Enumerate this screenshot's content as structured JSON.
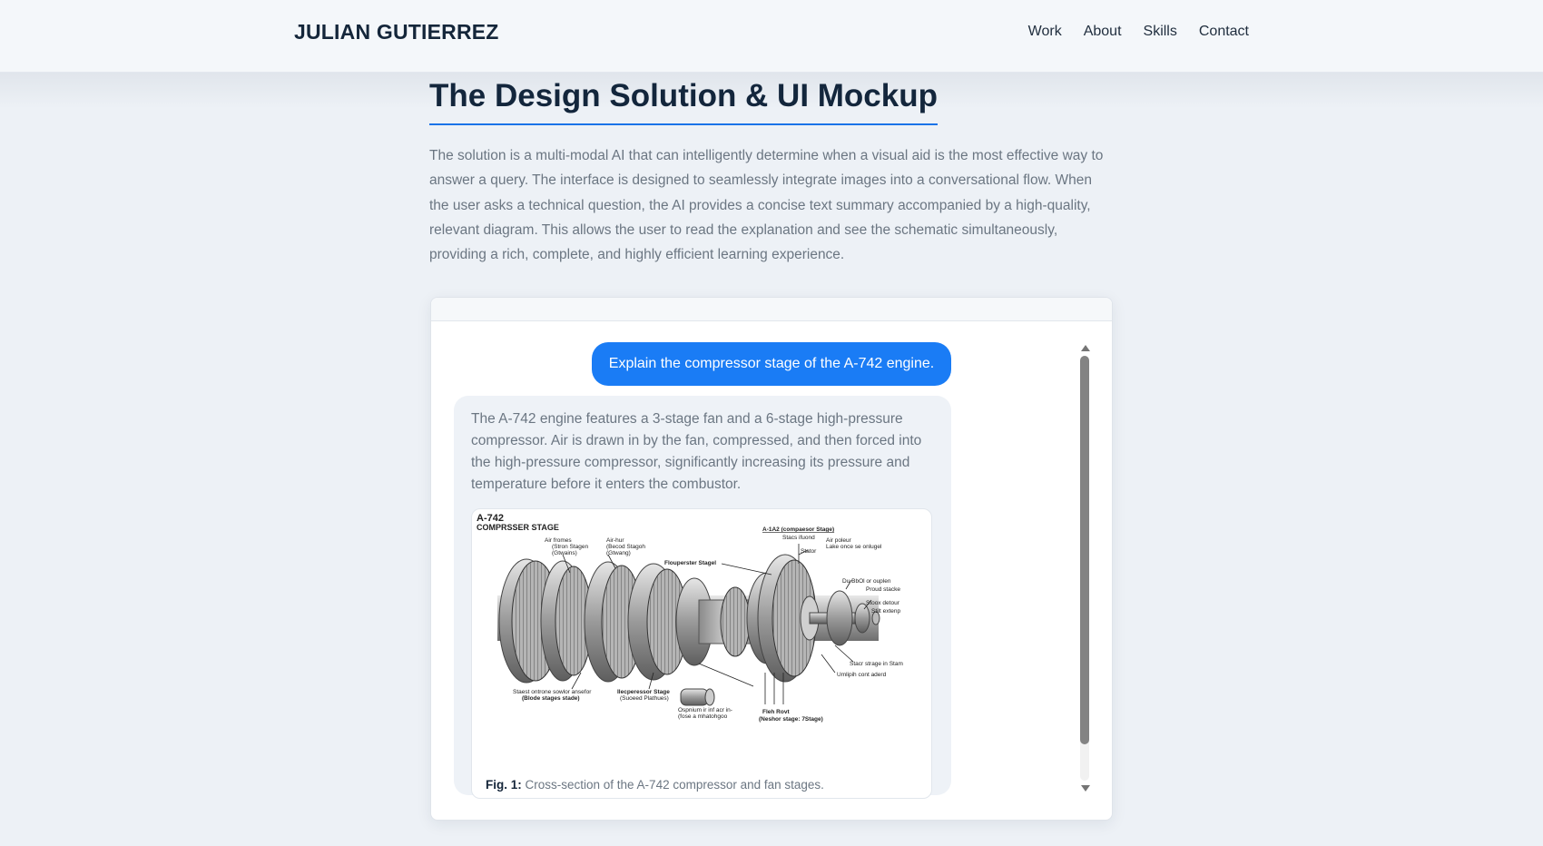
{
  "header": {
    "brand": "JULIAN GUTIERREZ",
    "nav": [
      "Work",
      "About",
      "Skills",
      "Contact"
    ]
  },
  "section": {
    "title": "The Design Solution & UI Mockup",
    "description": "The solution is a multi-modal AI that can intelligently determine when a visual aid is the most effective way to answer a query. The interface is designed to seamlessly integrate images into a conversational flow. When the user asks a technical question, the AI provides a concise text summary accompanied by a high-quality, relevant diagram. This allows the user to read the explanation and see the schematic simultaneously, providing a rich, complete, and highly efficient learning experience."
  },
  "chat": {
    "user_message": "Explain the compressor stage of the A-742 engine.",
    "ai_message": "The A-742 engine features a 3-stage fan and a 6-stage high-pressure compressor. Air is drawn in by the fan, compressed, and then forced into the high-pressure compressor, significantly increasing its pressure and temperature before it enters the combustor.",
    "figure": {
      "caption_label": "Fig. 1:",
      "caption_text": " Cross-section of the A-742 compressor and fan stages.",
      "diagram": {
        "title_line1": "A-742",
        "title_line2": "COMPRSSER STAGE",
        "labels": {
          "top_right_title": "A-1A2 (compaesor Stage)",
          "stack_ifund": "Stacs ifuond",
          "air_poleur": "Air poleur",
          "lake_once": "Lake once se onlugel",
          "stator": "Stator",
          "air_fromes": "Air fromes",
          "stron_stagen": "(Stron Stagen",
          "gtwains": "(Gtwains)",
          "air_hur": "Air-hur",
          "becod_stagoh": "(Becod Stagoh",
          "gtwang": "(Gtwang)",
          "flouperster": "Flouperster Stagel",
          "du_bbol": "Du BbOl or ouplen",
          "proud_stacke": "Proud stacke",
          "stoox_detour": "Stoox detour",
          "stilt_extenp": "Stilt extenp",
          "stacr_strage": "Stacr strage in Stam",
          "umlipih": "Umlipih cont aderd",
          "staest_ontrone": "Staest ontrone sowlor ansefor",
          "blode_stages": "(Blode stages stade)",
          "ilecperessor": "Ilecperessor Stage",
          "suoeed": "(Suoeed Plathues)",
          "ospnium": "Ospnium ir inf acr in-",
          "fose": "(fose a mhatohgoo",
          "fleh_rovt": "Fleh Rovt",
          "neshor": "(Neshor stage: 7Stage)"
        }
      }
    }
  }
}
